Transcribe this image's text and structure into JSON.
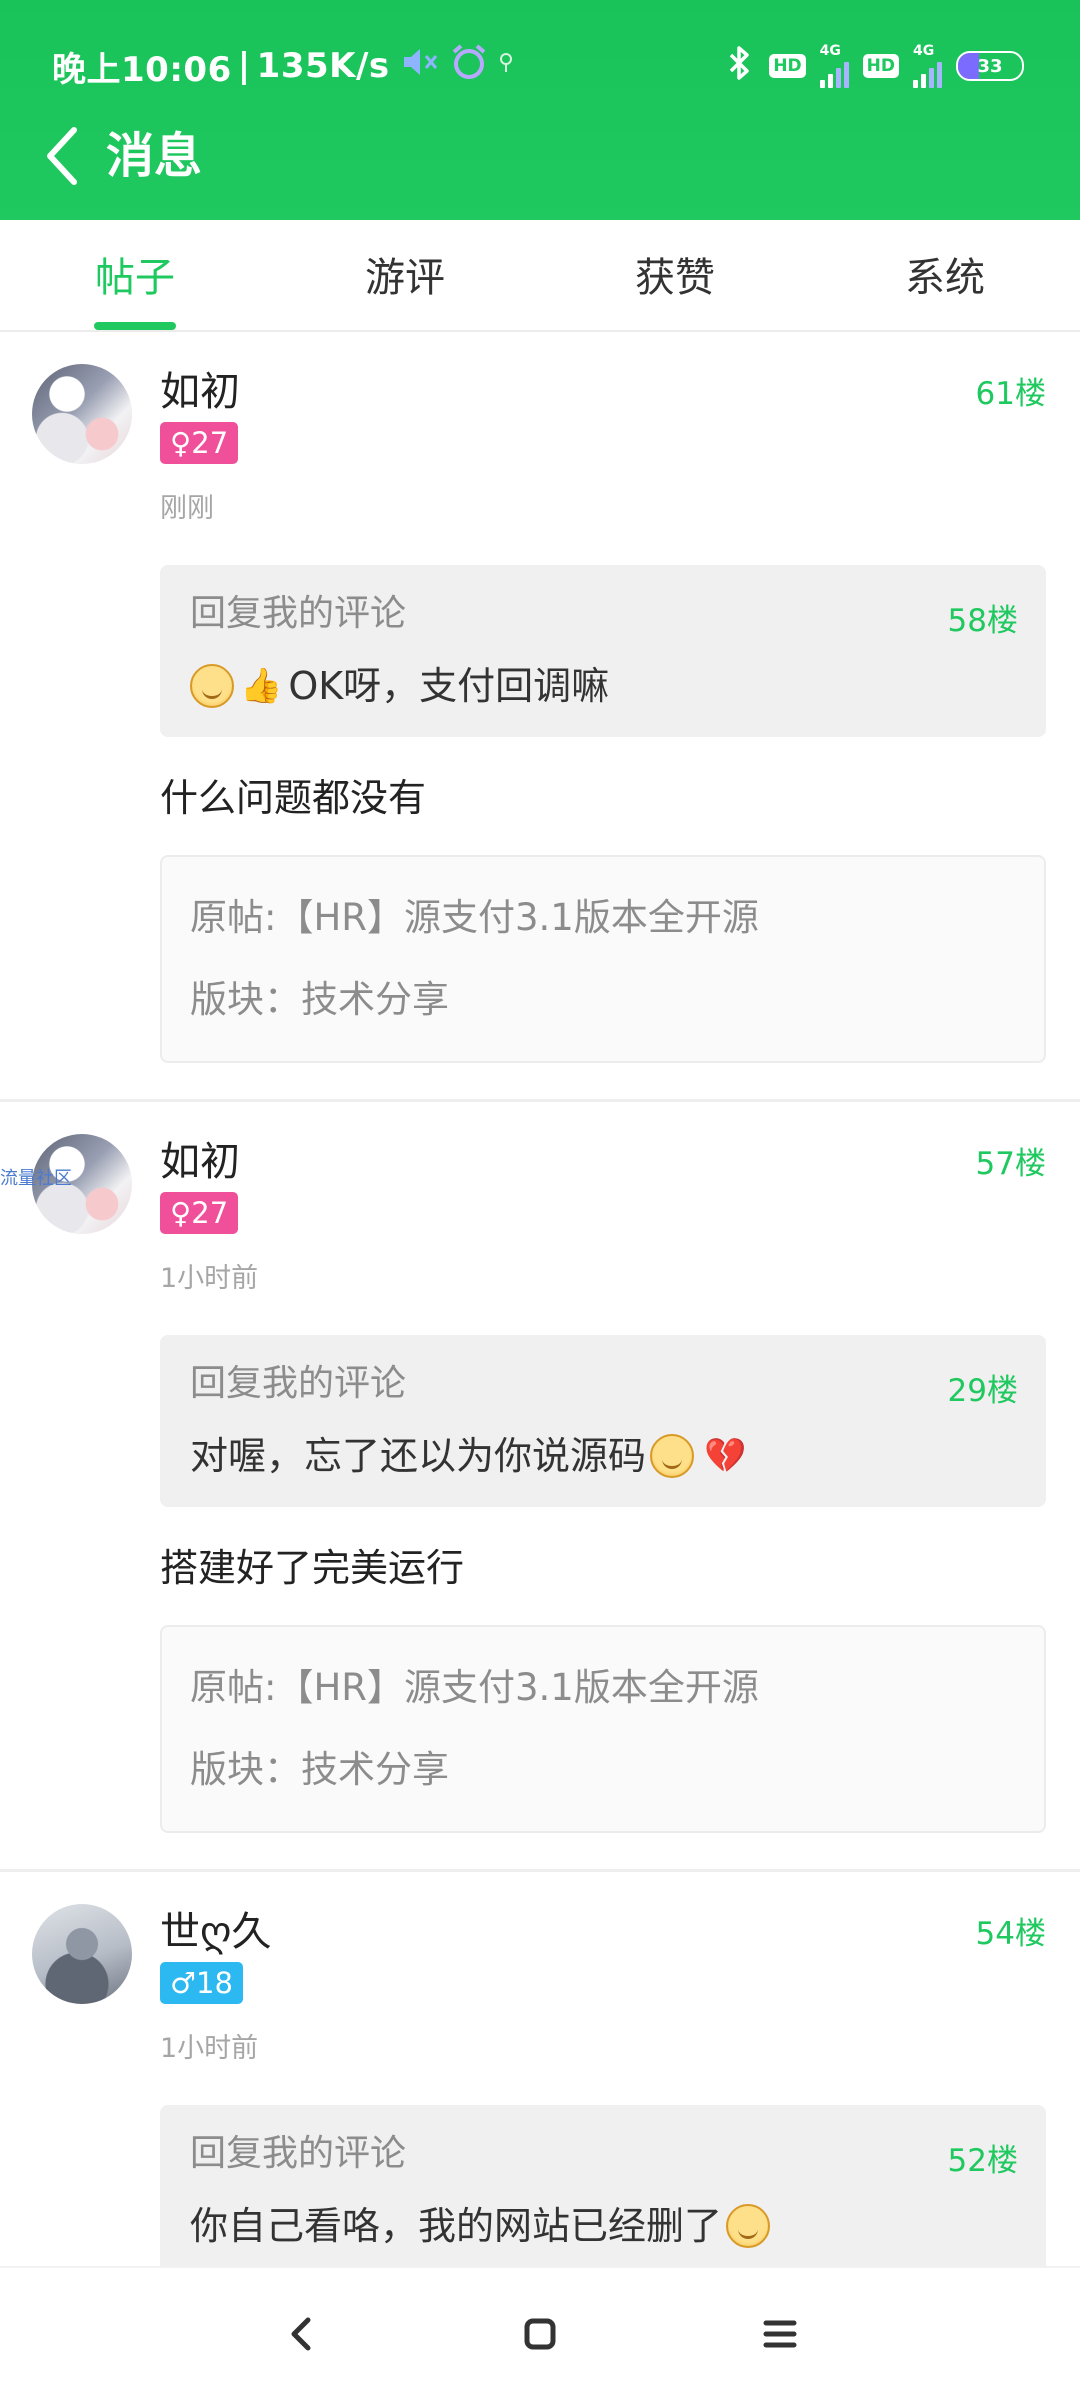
{
  "status_bar": {
    "time": "晚上10:06",
    "speed": "135K/s",
    "separator": "|",
    "mute_icon": "mute-icon",
    "alarm_icon": "alarm-icon",
    "location_icon": "location-icon",
    "bluetooth_icon": "bluetooth-icon",
    "hd1": "HD",
    "net1": "4G",
    "hd2": "HD",
    "net2": "4G",
    "battery": "33",
    "battery_level": 0.33
  },
  "header": {
    "title": "消息",
    "back_icon": "back-arrow-icon"
  },
  "tabs": [
    {
      "label": "帖子",
      "active": true
    },
    {
      "label": "游评",
      "active": false
    },
    {
      "label": "获赞",
      "active": false
    },
    {
      "label": "系统",
      "active": false
    }
  ],
  "messages": [
    {
      "username": "如初",
      "gender_symbol": "♀",
      "age": "27",
      "badge": "♀27",
      "time": "刚刚",
      "floor": "61楼",
      "reply_label": "回复我的评论",
      "reply_floor": "58楼",
      "reply_text": "OK呀，支付回调嘛",
      "comment": "什么问题都没有",
      "orig_post": "原帖:【HR】源支付3.1版本全开源",
      "section": "版块：技术分享"
    },
    {
      "username": "如初",
      "watermark": "流量社区",
      "badge": "♀27",
      "time": "1小时前",
      "floor": "57楼",
      "reply_label": "回复我的评论",
      "reply_floor": "29楼",
      "reply_text": "对喔，忘了还以为你说源码",
      "comment": "搭建好了完美运行",
      "orig_post": "原帖:【HR】源支付3.1版本全开源",
      "section": "版块：技术分享"
    },
    {
      "username": "世ღ久",
      "badge": "♂18",
      "time": "1小时前",
      "floor": "54楼",
      "reply_label": "回复我的评论",
      "reply_floor": "52楼",
      "reply_text": "你自己看咯，我的网站已经删了"
    }
  ],
  "nav": {
    "back": "nav-back-icon",
    "home": "nav-home-icon",
    "menu": "nav-menu-icon"
  },
  "colors": {
    "accent": "#1fc95f",
    "female": "#f0509a",
    "male": "#2cb8f0"
  }
}
